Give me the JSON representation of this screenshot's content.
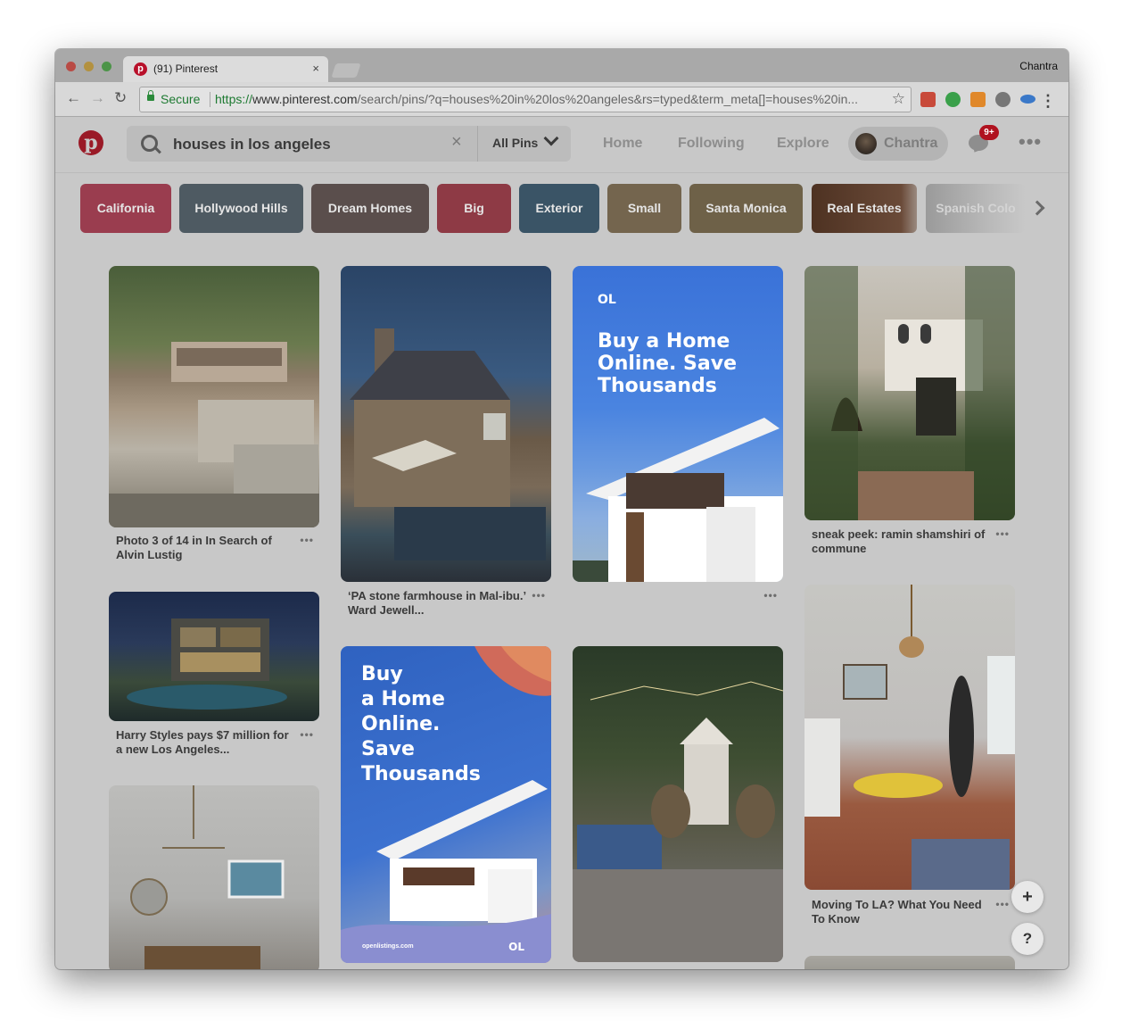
{
  "browser": {
    "tab_title": "(91) Pinterest",
    "tab_close": "×",
    "favicon_glyph": "p",
    "profile_name": "Chantra",
    "secure_label": "Secure",
    "url_scheme": "https://",
    "url_host": "www.pinterest.com",
    "url_path": "/search/pins/?q=houses%20in%20los%20angeles&rs=typed&term_meta[]=houses%20in...",
    "back_glyph": "←",
    "forward_glyph": "→",
    "reload_glyph": "↻",
    "star_glyph": "☆",
    "menu_glyph": "⋮",
    "extensions": [
      {
        "name": "calendar-extension-icon",
        "color": "#c84a3a"
      },
      {
        "name": "grammarly-extension-icon",
        "color": "#3aa04a"
      },
      {
        "name": "analytics-extension-icon",
        "color": "#e0882a"
      },
      {
        "name": "pinterest-extension-icon",
        "color": "#777777"
      },
      {
        "name": "salesforce-extension-icon",
        "color": "#3a78c8"
      }
    ]
  },
  "header": {
    "logo_glyph": "p",
    "search_value": "houses in los angeles",
    "search_clear": "×",
    "filter_label": "All Pins",
    "nav": [
      "Home",
      "Following",
      "Explore"
    ],
    "user_name": "Chantra",
    "notifications_badge": "9+",
    "more": "•••"
  },
  "guides": [
    {
      "label": "California",
      "color": "#9a3d4f"
    },
    {
      "label": "Hollywood Hills",
      "color": "#4e5a62"
    },
    {
      "label": "Dream Homes",
      "color": "#5a4e4c"
    },
    {
      "label": "Big",
      "color": "#8e3a45"
    },
    {
      "label": "Exterior",
      "color": "#3a5466"
    },
    {
      "label": "Small",
      "color": "#74654e"
    },
    {
      "label": "Santa Monica",
      "color": "#6e6148"
    },
    {
      "label": "Real Estates",
      "color": "#5a3a2a"
    },
    {
      "label": "Spanish Colo",
      "color": "#9a9a9a"
    }
  ],
  "pins": [
    {
      "title": "Photo 3 of 14 in In Search of Alvin Lustig",
      "dots": "•••"
    },
    {
      "title": "Harry Styles pays $7 million for a new Los Angeles...",
      "dots": "•••"
    },
    {
      "title": "‘PA stone farmhouse in Mal-ibu.’ Ward Jewell...",
      "dots": "•••"
    },
    {
      "title": "",
      "dots": "•••"
    },
    {
      "title": "sneak peek: ramin shamshiri of commune",
      "dots": "•••"
    },
    {
      "title": "Moving To LA? What You Need To Know",
      "dots": "•••"
    }
  ],
  "ads": {
    "logo": "OL",
    "headline_1": "Buy a Home Online. Save Thousands",
    "headline_2_l1": "Buy",
    "headline_2_l2": "a Home",
    "headline_2_l3": "Online.",
    "headline_2_l4": "Save",
    "headline_2_l5": "Thousands",
    "footer_url": "openlistings.com"
  },
  "fab": {
    "add": "+",
    "help": "?"
  }
}
